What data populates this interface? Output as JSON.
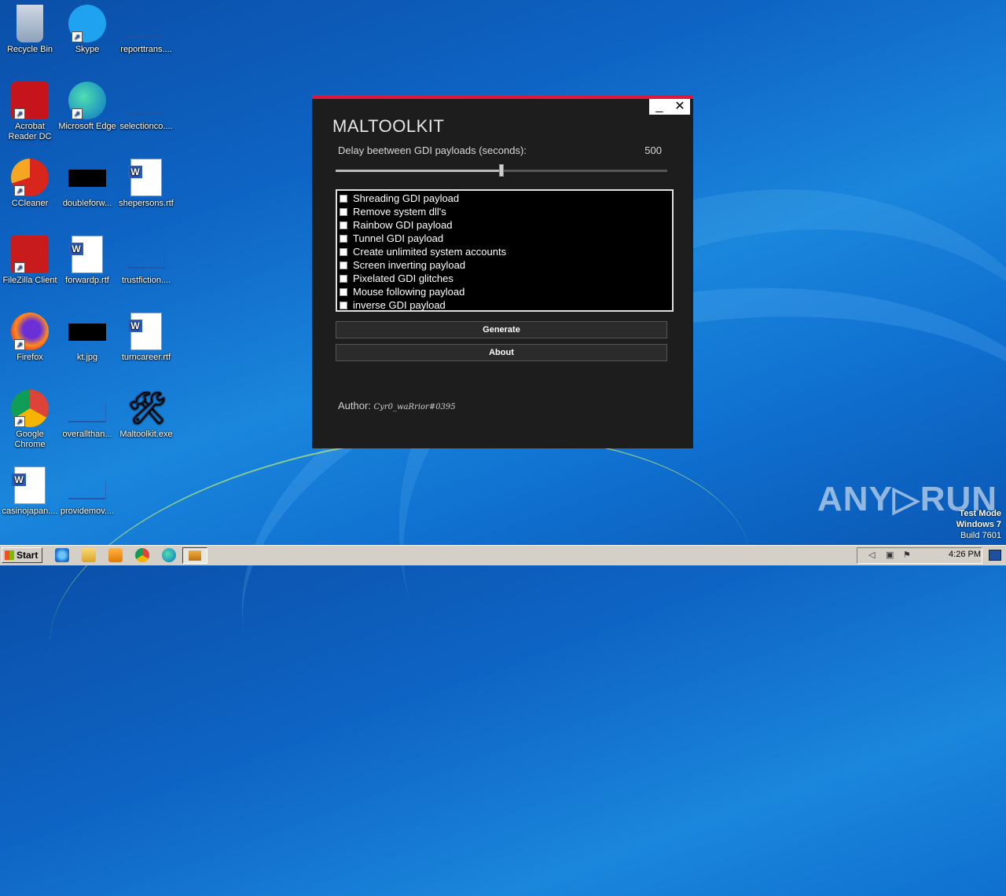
{
  "desktop": {
    "icons": [
      {
        "label": "Recycle Bin"
      },
      {
        "label": "Skype"
      },
      {
        "label": "reporttrans...."
      },
      {
        "label": "Acrobat Reader DC"
      },
      {
        "label": "Microsoft Edge"
      },
      {
        "label": "selectionco...."
      },
      {
        "label": "CCleaner"
      },
      {
        "label": "doubleforw..."
      },
      {
        "label": "shepersons.rtf"
      },
      {
        "label": "FileZilla Client"
      },
      {
        "label": "forwardp.rtf"
      },
      {
        "label": "trustfiction...."
      },
      {
        "label": "Firefox"
      },
      {
        "label": "kt.jpg"
      },
      {
        "label": "turncareer.rtf"
      },
      {
        "label": "Google Chrome"
      },
      {
        "label": "overallthan..."
      },
      {
        "label": "Maltoolkit.exe"
      },
      {
        "label": "casinojapan...."
      },
      {
        "label": "providemov...."
      }
    ]
  },
  "window": {
    "title": "MALTOOLKIT",
    "minimize": "_",
    "close": "✕",
    "delay_label": "Delay beetween GDI payloads (seconds):",
    "delay_value": "500",
    "slider_fraction": 0.5,
    "payloads": [
      "Shreading GDI payload",
      "Remove system dll's",
      "Rainbow GDI payload",
      "Tunnel GDI payload",
      "Create unlimited system accounts",
      "Screen inverting payload",
      "Pixelated GDI glitches",
      "Mouse following payload",
      "inverse GDI payload"
    ],
    "generate_label": "Generate",
    "about_label": "About",
    "author_prefix": "Author:",
    "author_name": "Cyr0_waRrior#0395"
  },
  "watermark": {
    "brand": "ANY▷RUN",
    "test_mode": "Test Mode",
    "os": "Windows 7",
    "build": "Build 7601"
  },
  "taskbar": {
    "start_label": "Start",
    "clock": "4:26 PM"
  }
}
